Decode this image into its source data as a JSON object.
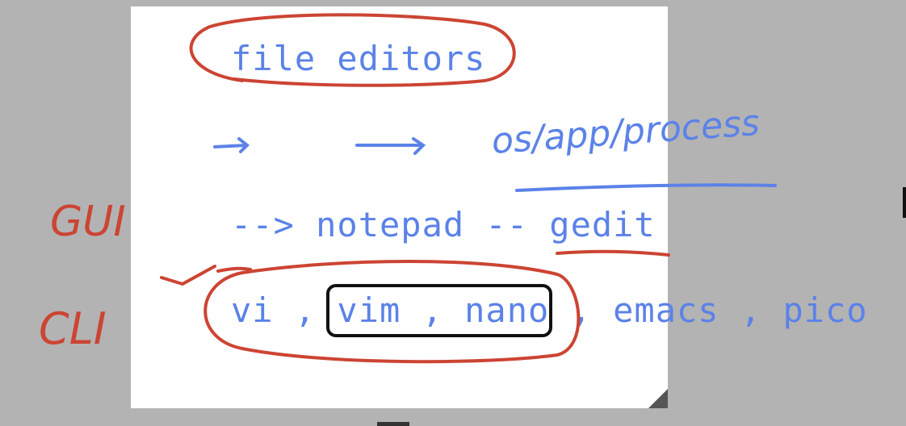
{
  "typed_lines": {
    "line1": "file editors",
    "line2": "--> notepad -- gedit",
    "line3": "vi , vim , nano , emacs , pico"
  },
  "handwriting": {
    "os_note": "os/app/process",
    "gui": "GUI",
    "cli": "CLI"
  },
  "colors": {
    "typed_text": "#5b82e8",
    "red_ink": "#cc4433",
    "blue_ink": "#5b82e8",
    "black_ink": "#111111"
  }
}
